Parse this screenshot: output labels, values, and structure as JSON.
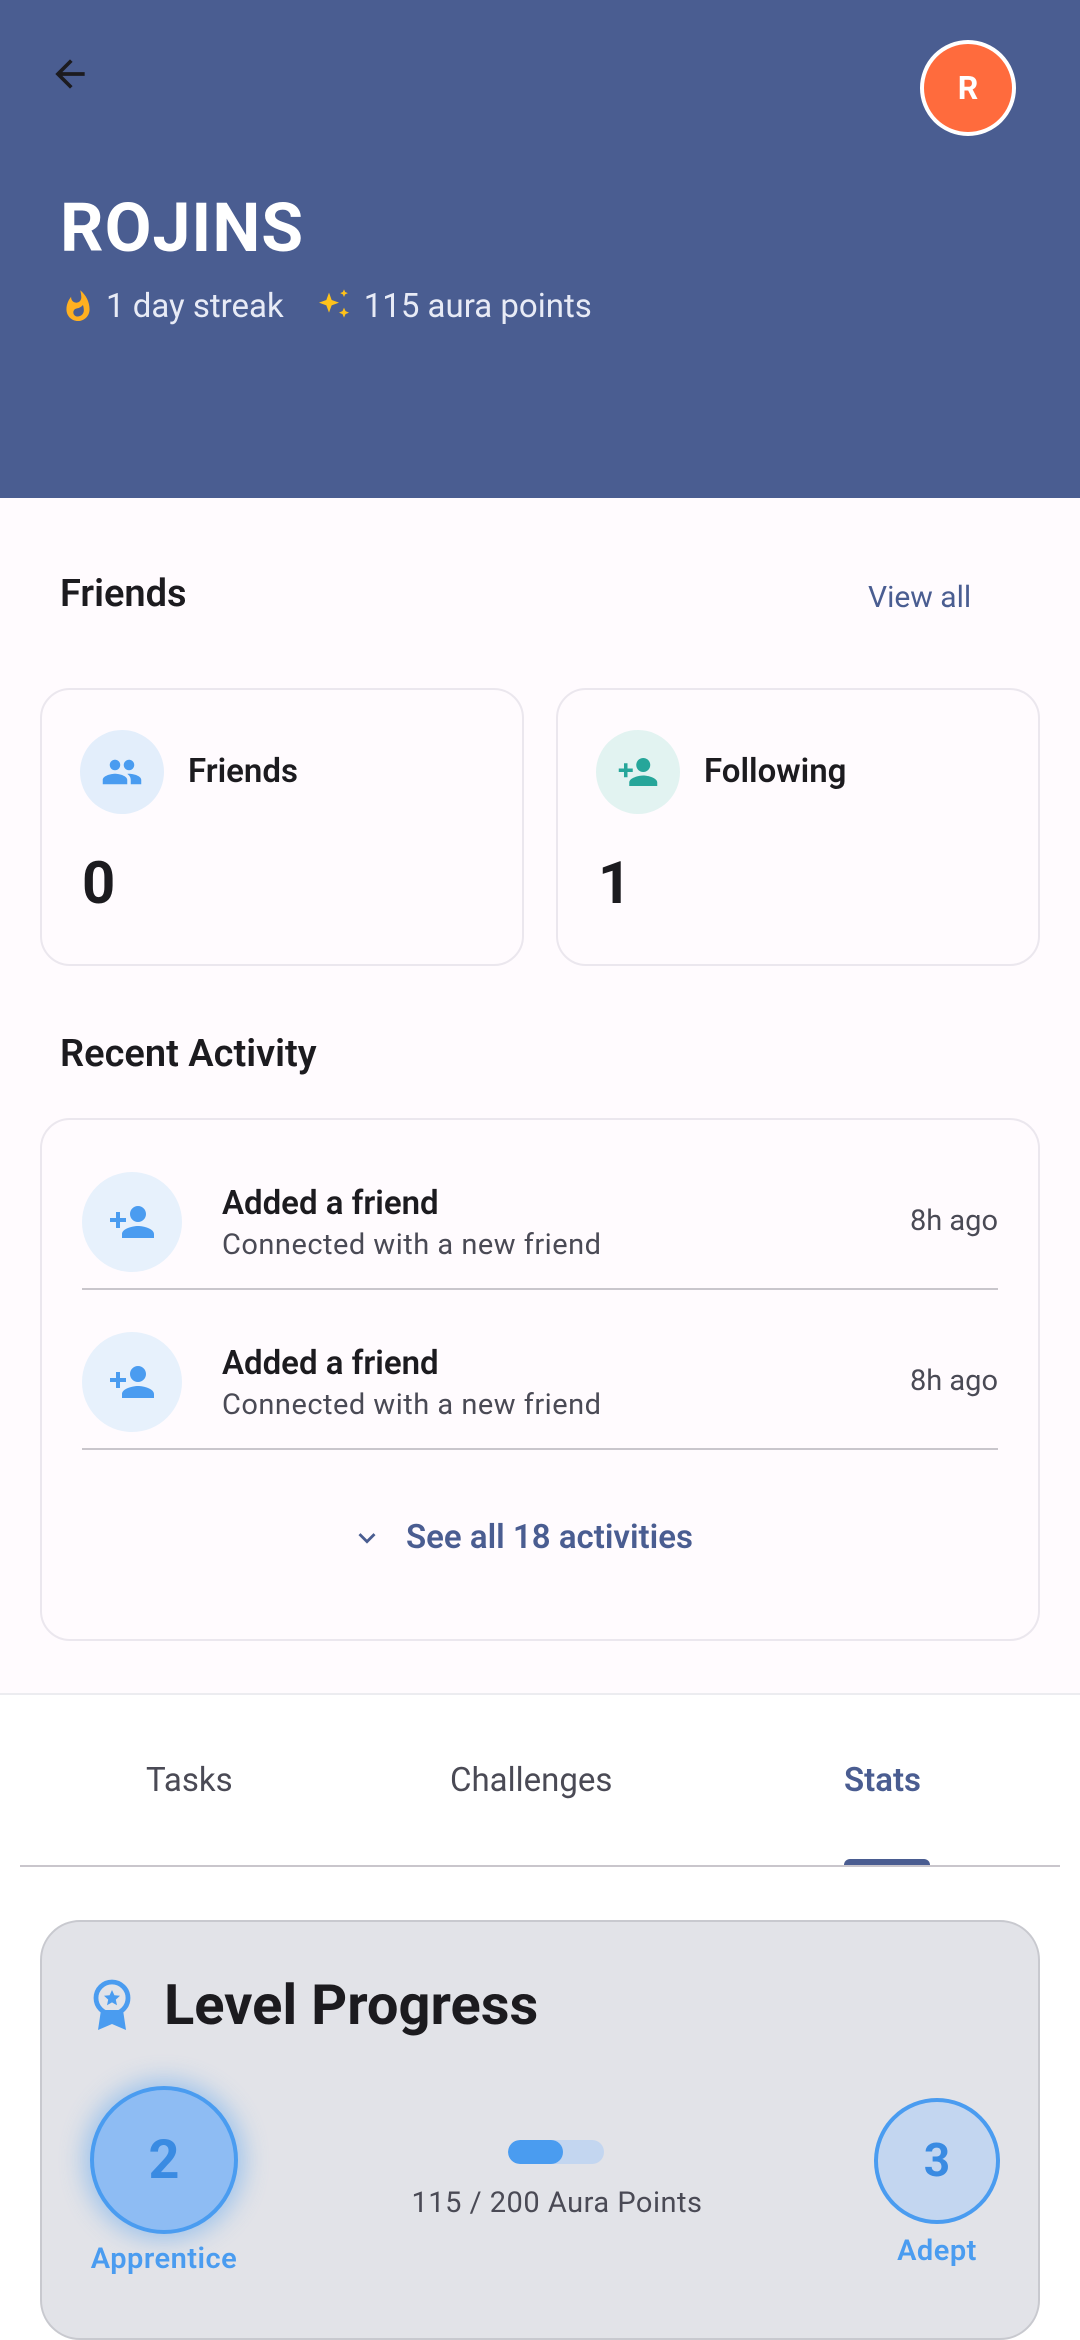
{
  "header": {
    "name": "ROJINS",
    "avatar_initial": "R",
    "streak_text": "1 day streak",
    "aura_text": "115 aura points",
    "background": "#4a5d91",
    "avatar_color": "#ff6b3d"
  },
  "friends_section": {
    "title": "Friends",
    "view_all": "View all",
    "cards": [
      {
        "label": "Friends",
        "count": "0",
        "icon": "people-icon"
      },
      {
        "label": "Following",
        "count": "1",
        "icon": "person-add-icon"
      }
    ]
  },
  "activity_section": {
    "title": "Recent Activity",
    "items": [
      {
        "title": "Added a friend",
        "subtitle": "Connected with a new friend",
        "time": "8h ago"
      },
      {
        "title": "Added a friend",
        "subtitle": "Connected with a new friend",
        "time": "8h ago"
      }
    ],
    "see_all": "See all 18 activities"
  },
  "tabs": {
    "items": [
      "Tasks",
      "Challenges",
      "Stats"
    ],
    "active": "Stats"
  },
  "level_progress": {
    "title": "Level Progress",
    "current_level": "2",
    "current_label": "Apprentice",
    "next_level": "3",
    "next_label": "Adept",
    "progress_text": "115 / 200 Aura Points",
    "progress_fraction": 0.575
  }
}
